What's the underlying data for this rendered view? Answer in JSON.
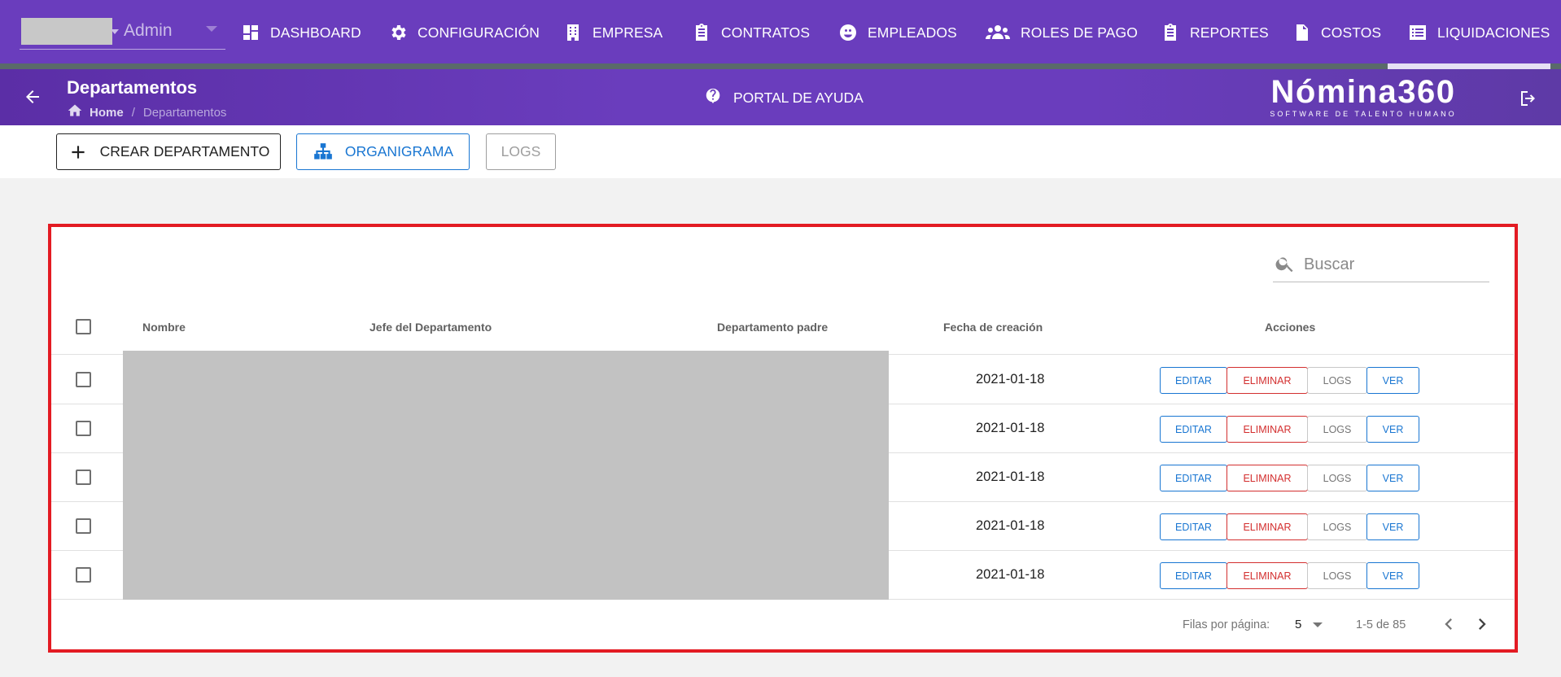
{
  "user": {
    "name": "Admin"
  },
  "nav": [
    {
      "label": "DASHBOARD",
      "icon": "dashboard-icon"
    },
    {
      "label": "CONFIGURACIÓN",
      "icon": "gear-icon"
    },
    {
      "label": "EMPRESA",
      "icon": "building-icon"
    },
    {
      "label": "CONTRATOS",
      "icon": "clipboard-icon"
    },
    {
      "label": "EMPLEADOS",
      "icon": "face-icon"
    },
    {
      "label": "ROLES DE PAGO",
      "icon": "people-icon"
    },
    {
      "label": "REPORTES",
      "icon": "clipboard-icon"
    },
    {
      "label": "COSTOS",
      "icon": "dollar-file-icon"
    },
    {
      "label": "LIQUIDACIONES",
      "icon": "list-icon"
    }
  ],
  "header": {
    "title": "Departamentos",
    "breadcrumb_home": "Home",
    "breadcrumb_sep": "/",
    "breadcrumb_current": "Departamentos",
    "help_label": "PORTAL DE AYUDA",
    "brand": "Nómina360",
    "brand_tagline": "SOFTWARE DE TALENTO HUMANO"
  },
  "toolbar": {
    "create_label": "CREAR DEPARTAMENTO",
    "org_label": "ORGANIGRAMA",
    "logs_label": "LOGS"
  },
  "search": {
    "placeholder": "Buscar"
  },
  "table": {
    "columns": [
      "Nombre",
      "Jefe del Departamento",
      "Departamento padre",
      "Fecha de creación",
      "Acciones"
    ],
    "rows": [
      {
        "date": "2021-01-18"
      },
      {
        "date": "2021-01-18"
      },
      {
        "date": "2021-01-18"
      },
      {
        "date": "2021-01-18"
      },
      {
        "date": "2021-01-18"
      }
    ],
    "actions": {
      "edit": "EDITAR",
      "delete": "ELIMINAR",
      "logs": "LOGS",
      "view": "VER"
    }
  },
  "pagination": {
    "rows_per_page_label": "Filas por página:",
    "rows_per_page": "5",
    "range": "1-5 de 85"
  },
  "colors": {
    "nav_bg": "#6a3dbd",
    "primary": "#1976d2",
    "danger": "#d32f2f",
    "highlight_frame": "#e31b23"
  }
}
